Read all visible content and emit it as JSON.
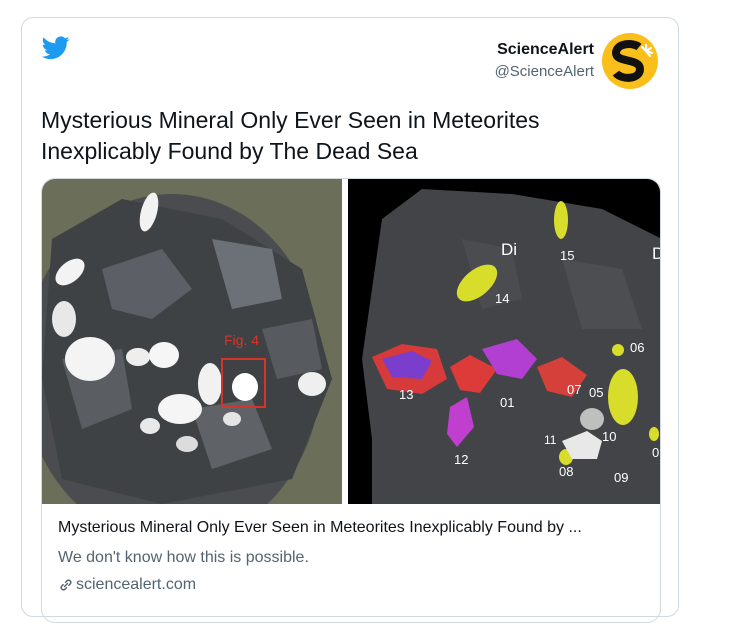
{
  "author": {
    "display_name": "ScienceAlert",
    "handle": "@ScienceAlert"
  },
  "tweet": {
    "text": "Mysterious Mineral Only Ever Seen in Meteorites Inexplicably Found by The Dead Sea"
  },
  "link_card": {
    "title": "Mysterious Mineral Only Ever Seen in Meteorites Inexplicably Found by ...",
    "description": "We don't know how this is possible.",
    "domain": "sciencealert.com"
  },
  "media": {
    "left_label": "Fig. 4",
    "right_labels": [
      "Di",
      "15",
      "14",
      "13",
      "01",
      "07",
      "05",
      "06",
      "11",
      "10",
      "12",
      "08",
      "09",
      "D",
      "0"
    ]
  },
  "colors": {
    "twitter_blue": "#1d9bf0",
    "avatar_yellow": "#fbbf1b",
    "border": "#cfd9de",
    "secondary_text": "#536471"
  },
  "icons": {
    "bird": "twitter-bird-icon",
    "link": "link-icon"
  }
}
